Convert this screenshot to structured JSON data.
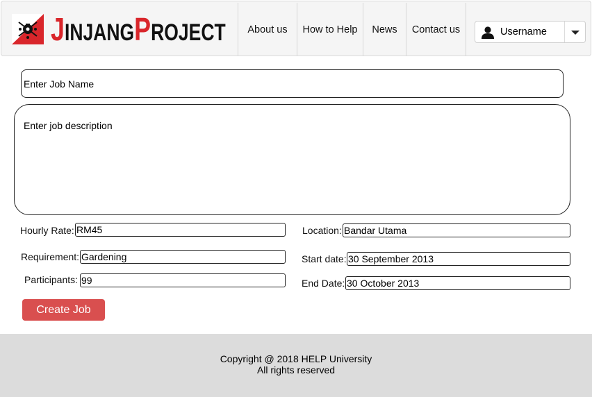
{
  "header": {
    "logo": {
      "initial_1": "J",
      "rest_1": "INJANG",
      "initial_2": "P",
      "rest_2": "ROJECT"
    },
    "nav": [
      "About us",
      "How to Help",
      "News",
      "Contact us"
    ],
    "user": {
      "name": "Username",
      "icon": "user-icon"
    }
  },
  "form": {
    "job_name_placeholder": "Enter Job Name",
    "job_description_placeholder": "Enter job description",
    "hourly_rate": {
      "label": "Hourly Rate:",
      "value": "RM45"
    },
    "location": {
      "label": "Location:",
      "value": "Bandar Utama"
    },
    "requirement": {
      "label": "Requirement:",
      "value": "Gardening"
    },
    "start_date": {
      "label": "Start date:",
      "value": "30 September 2013"
    },
    "participants": {
      "label": "Participants:",
      "value": "99"
    },
    "end_date": {
      "label": "End Date:",
      "value": "30 October 2013"
    },
    "submit_label": "Create Job"
  },
  "footer": {
    "line1": "Copyright @ 2018 HELP University",
    "line2": "All rights reserved"
  },
  "colors": {
    "brand_red": "#d9262b",
    "button_red": "#d94f4f",
    "footer_bg": "#dcdcdc",
    "navbar_bg": "#f5f5f5"
  }
}
